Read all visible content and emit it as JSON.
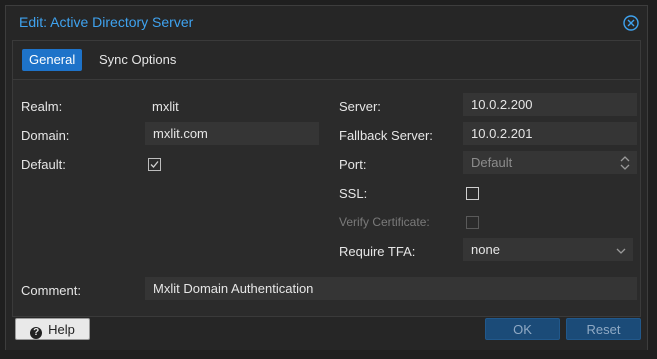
{
  "dialog": {
    "title": "Edit: Active Directory Server"
  },
  "tabs": [
    {
      "label": "General",
      "active": true
    },
    {
      "label": "Sync Options",
      "active": false
    }
  ],
  "left": {
    "realm_label": "Realm:",
    "realm_value": "mxlit",
    "domain_label": "Domain:",
    "domain_value": "mxlit.com",
    "default_label": "Default:",
    "default_checked": true
  },
  "right": {
    "server_label": "Server:",
    "server_value": "10.0.2.200",
    "fallback_label": "Fallback Server:",
    "fallback_value": "10.0.2.201",
    "port_label": "Port:",
    "port_placeholder": "Default",
    "ssl_label": "SSL:",
    "ssl_checked": false,
    "verify_label": "Verify Certificate:",
    "verify_checked": false,
    "tfa_label": "Require TFA:",
    "tfa_value": "none"
  },
  "comment": {
    "label": "Comment:",
    "value": "Mxlit Domain Authentication"
  },
  "footer": {
    "help_label": "Help",
    "ok_label": "OK",
    "reset_label": "Reset"
  },
  "colors": {
    "accent": "#3fa3f0",
    "tab_active": "#1e73c9",
    "background": "#262626"
  }
}
